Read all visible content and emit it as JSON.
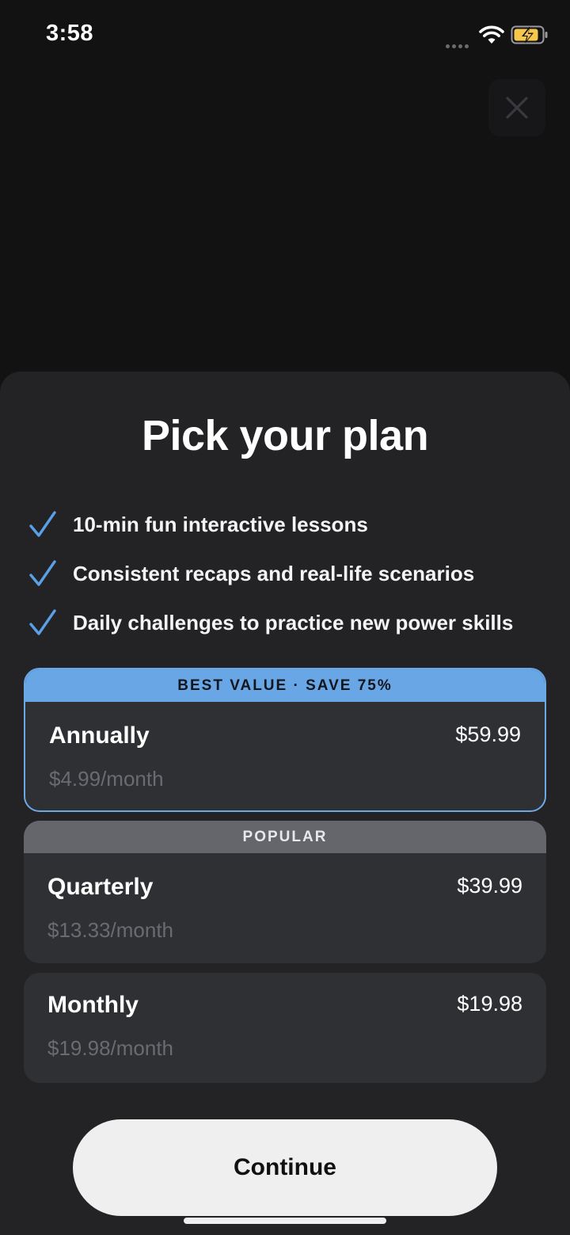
{
  "status_bar": {
    "time": "3:58"
  },
  "close": {
    "icon": "close-icon"
  },
  "sheet": {
    "title": "Pick your plan",
    "features": [
      "10-min fun interactive lessons",
      "Consistent recaps and real-life scenarios",
      "Daily challenges to practice new power skills"
    ]
  },
  "plans": [
    {
      "banner": "BEST VALUE · SAVE 75%",
      "name": "Annually",
      "price": "$59.99",
      "per_month": "$4.99/month",
      "selected": true
    },
    {
      "banner": "POPULAR",
      "name": "Quarterly",
      "price": "$39.99",
      "per_month": "$13.33/month",
      "selected": false
    },
    {
      "name": "Monthly",
      "price": "$19.98",
      "per_month": "$19.98/month",
      "selected": false
    }
  ],
  "continue_label": "Continue",
  "colors": {
    "accent": "#68a6e6",
    "sheet_bg": "#232326",
    "card_bg": "#2f3033",
    "popular_banner": "#65666b",
    "battery_fill": "#f5c84c"
  }
}
